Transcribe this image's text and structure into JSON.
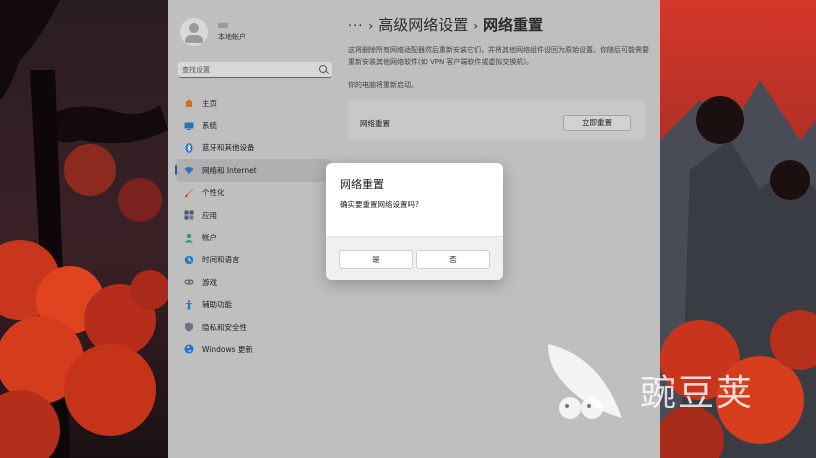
{
  "sidebar": {
    "user_name": "本地帐户",
    "search_placeholder": "查找设置",
    "items": [
      {
        "label": "主页",
        "icon": "home-icon",
        "color": "#c9742b"
      },
      {
        "label": "系统",
        "icon": "monitor-icon",
        "color": "#2a6fb8"
      },
      {
        "label": "蓝牙和其他设备",
        "icon": "bluetooth-icon",
        "color": "#1f6fd1"
      },
      {
        "label": "网络和 Internet",
        "icon": "wifi-icon",
        "color": "#2e74c8"
      },
      {
        "label": "个性化",
        "icon": "brush-icon",
        "color": "#d58a2a"
      },
      {
        "label": "应用",
        "icon": "apps-icon",
        "color": "#4a5a78"
      },
      {
        "label": "帐户",
        "icon": "account-icon",
        "color": "#2f9a6a"
      },
      {
        "label": "时间和语言",
        "icon": "globe-clock-icon",
        "color": "#2d7ec0"
      },
      {
        "label": "游戏",
        "icon": "gamepad-icon",
        "color": "#6d6d6d"
      },
      {
        "label": "辅助功能",
        "icon": "accessibility-icon",
        "color": "#1e7bd4"
      },
      {
        "label": "隐私和安全性",
        "icon": "shield-icon",
        "color": "#6b7380"
      },
      {
        "label": "Windows 更新",
        "icon": "sync-icon",
        "color": "#1f73c9"
      }
    ]
  },
  "breadcrumb": {
    "dots": "···",
    "parent": "高级网络设置",
    "current": "网络重置"
  },
  "content": {
    "description": "这将删除所有网络适配器然后重新安装它们，并将其他网络组件设回为原始设置。你随后可能需要重新安装其他网络软件(如 VPN 客户端软件或虚拟交换机)。",
    "restart_note": "你的电脑将重新启动。",
    "card_label": "网络重置",
    "reset_button": "立即重置"
  },
  "dialog": {
    "title": "网络重置",
    "message": "确实要重置网络设置吗?",
    "yes": "是",
    "no": "否"
  },
  "watermark": {
    "text": "豌豆荚"
  }
}
